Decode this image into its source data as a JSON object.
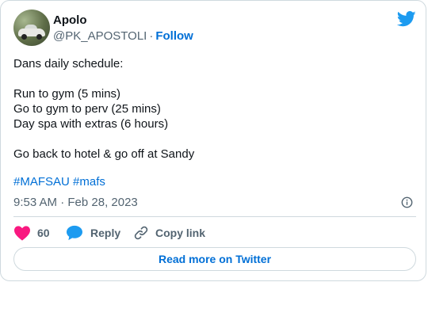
{
  "author": {
    "name": "Apolo",
    "handle": "@PK_APOSTOLI",
    "separator": "·",
    "follow_label": "Follow"
  },
  "tweet": {
    "lines": [
      "Dans daily schedule:",
      "",
      "Run to gym (5 mins)",
      "Go to gym to perv (25 mins)",
      "Day spa with extras (6 hours)",
      "",
      "Go back to hotel & go off at Sandy"
    ],
    "hashtags": [
      "#MAFSAU",
      "#mafs"
    ],
    "timestamp": "9:53 AM · Feb 28, 2023"
  },
  "actions": {
    "like_count": "60",
    "reply_label": "Reply",
    "copy_link_label": "Copy link"
  },
  "read_more_label": "Read more on Twitter",
  "icons": {
    "brand": "twitter-bird-icon",
    "info": "info-icon",
    "like": "heart-icon",
    "reply": "speech-bubble-icon",
    "copy": "link-icon"
  },
  "colors": {
    "link": "#006fd6",
    "twitter_blue": "#1d9bf0",
    "heart": "#f91880",
    "muted": "#536471",
    "border": "#cfd9de"
  }
}
